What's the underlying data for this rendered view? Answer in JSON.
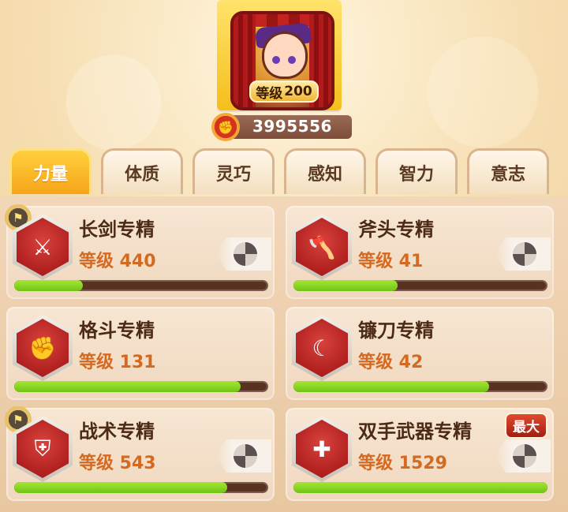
{
  "profile": {
    "level_label": "等级",
    "level_value": "200",
    "power_value": "3995556"
  },
  "tabs": [
    {
      "label": "力量",
      "active": true
    },
    {
      "label": "体质",
      "active": false
    },
    {
      "label": "灵巧",
      "active": false
    },
    {
      "label": "感知",
      "active": false
    },
    {
      "label": "智力",
      "active": false
    },
    {
      "label": "意志",
      "active": false
    }
  ],
  "skills": [
    {
      "name": "长剑专精",
      "level_text": "等级 440",
      "progress": 0.27,
      "icon": "sword-icon",
      "flag": true,
      "max": false,
      "swirl": true
    },
    {
      "name": "斧头专精",
      "level_text": "等级 41",
      "progress": 0.41,
      "icon": "axe-icon",
      "flag": false,
      "max": false,
      "swirl": true
    },
    {
      "name": "格斗专精",
      "level_text": "等级 131",
      "progress": 0.89,
      "icon": "fist-icon",
      "flag": false,
      "max": false,
      "swirl": false
    },
    {
      "name": "镰刀专精",
      "level_text": "等级 42",
      "progress": 0.77,
      "icon": "scythe-icon",
      "flag": false,
      "max": false,
      "swirl": false
    },
    {
      "name": "战术专精",
      "level_text": "等级 543",
      "progress": 0.84,
      "icon": "tactics-icon",
      "flag": true,
      "max": false,
      "swirl": true
    },
    {
      "name": "双手武器专精",
      "level_text": "等级 1529",
      "progress": 1.0,
      "icon": "two-handed-weapon-icon",
      "flag": false,
      "max": true,
      "swirl": true
    }
  ],
  "max_label": "最大",
  "colors": {
    "accent": "#f6a518",
    "progress": "#7ccf1c",
    "level_text": "#d46a21",
    "hex_icon": "#b0201f"
  }
}
